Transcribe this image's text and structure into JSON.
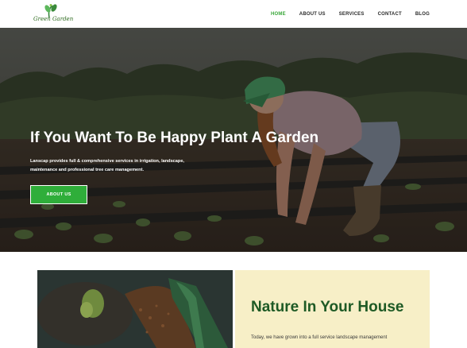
{
  "brand": {
    "logo_text": "Green Garden"
  },
  "nav": {
    "items": [
      {
        "label": "HOME",
        "active": true
      },
      {
        "label": "ABOUT US",
        "active": false
      },
      {
        "label": "SERVICES",
        "active": false
      },
      {
        "label": "CONTACT",
        "active": false
      },
      {
        "label": "BLOG",
        "active": false
      }
    ]
  },
  "hero": {
    "title": "If You Want To Be Happy Plant A Garden",
    "description": "Lanscap provides full & comprehensive services in irrigation, landscape, maintenance and professional tree care management.",
    "button_label": "ABOUT US"
  },
  "about": {
    "title": "Nature In Your House",
    "text": "Today, we have grown into a full service landscape management"
  },
  "colors": {
    "accent": "#2fae3a",
    "active_nav": "#3aa83a",
    "heading_green": "#1e5a25",
    "panel_bg": "#f7efc7"
  }
}
